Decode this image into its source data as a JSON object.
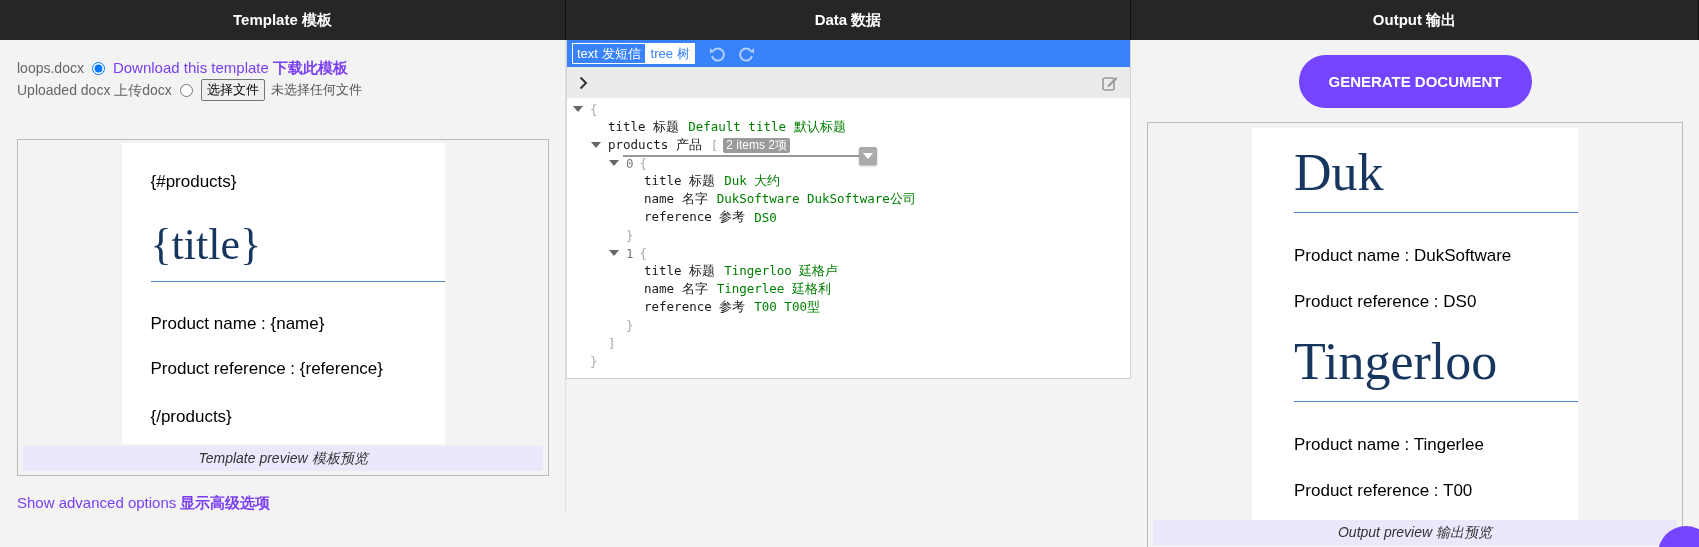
{
  "columns": [
    {
      "title": "Template 模板"
    },
    {
      "title": "Data 数据"
    },
    {
      "title": "Output 输出"
    }
  ],
  "template": {
    "options": [
      {
        "label": "loops.docx",
        "selected": true,
        "link": "Download this template **下载此模板**"
      },
      {
        "label": "Uploaded docx 上传docx",
        "selected": false,
        "file_button": "选择文件",
        "file_status": "未选择任何文件"
      }
    ],
    "preview": {
      "lines": [
        {
          "kind": "tag",
          "text": "{#products}"
        },
        {
          "kind": "heading",
          "text": "{title}"
        },
        {
          "kind": "field",
          "text": "Product name : {name}"
        },
        {
          "kind": "field",
          "text": "Product reference : {reference}"
        },
        {
          "kind": "tag",
          "text": "{/products}"
        }
      ],
      "caption": "Template preview 模板预览"
    },
    "advanced_link": "Show advanced options **显示高级选项**"
  },
  "editor": {
    "modes": [
      {
        "label": "text 发短信",
        "selected": true
      },
      {
        "label": "tree 树",
        "selected": false
      }
    ],
    "tree": {
      "open": "{",
      "close": "}",
      "expanded": true,
      "children": [
        {
          "key": "title 标题",
          "value": "Default title 默认标题"
        },
        {
          "key": "products 产品",
          "open": "[",
          "close": "]",
          "badge": "2 items 2项",
          "expanded": true,
          "children": [
            {
              "index": "0",
              "open": "{",
              "close": "}",
              "expanded": true,
              "children": [
                {
                  "key": "title 标题",
                  "value": "Duk 大约"
                },
                {
                  "key": "name 名字",
                  "value": "DukSoftware DukSoftware公司"
                },
                {
                  "key": "reference 参考",
                  "value": "DS0"
                }
              ]
            },
            {
              "index": "1",
              "open": "{",
              "close": "}",
              "expanded": true,
              "children": [
                {
                  "key": "title 标题",
                  "value": "Tingerloo 廷格卢"
                },
                {
                  "key": "name 名字",
                  "value": "Tingerlee 廷格利"
                },
                {
                  "key": "reference 参考",
                  "value": "T00 T00型"
                }
              ]
            }
          ]
        }
      ]
    }
  },
  "output": {
    "button": "GENERATE DOCUMENT",
    "preview": {
      "lines": [
        {
          "kind": "heading",
          "text": "Duk"
        },
        {
          "kind": "field",
          "text": "Product name : DukSoftware"
        },
        {
          "kind": "field",
          "text": "Product reference : DS0"
        },
        {
          "kind": "heading",
          "text": "Tingerloo"
        },
        {
          "kind": "field",
          "text": "Product name : Tingerlee"
        },
        {
          "kind": "field",
          "text": "Product reference : T00"
        }
      ],
      "caption": "Output preview 输出预览"
    }
  }
}
